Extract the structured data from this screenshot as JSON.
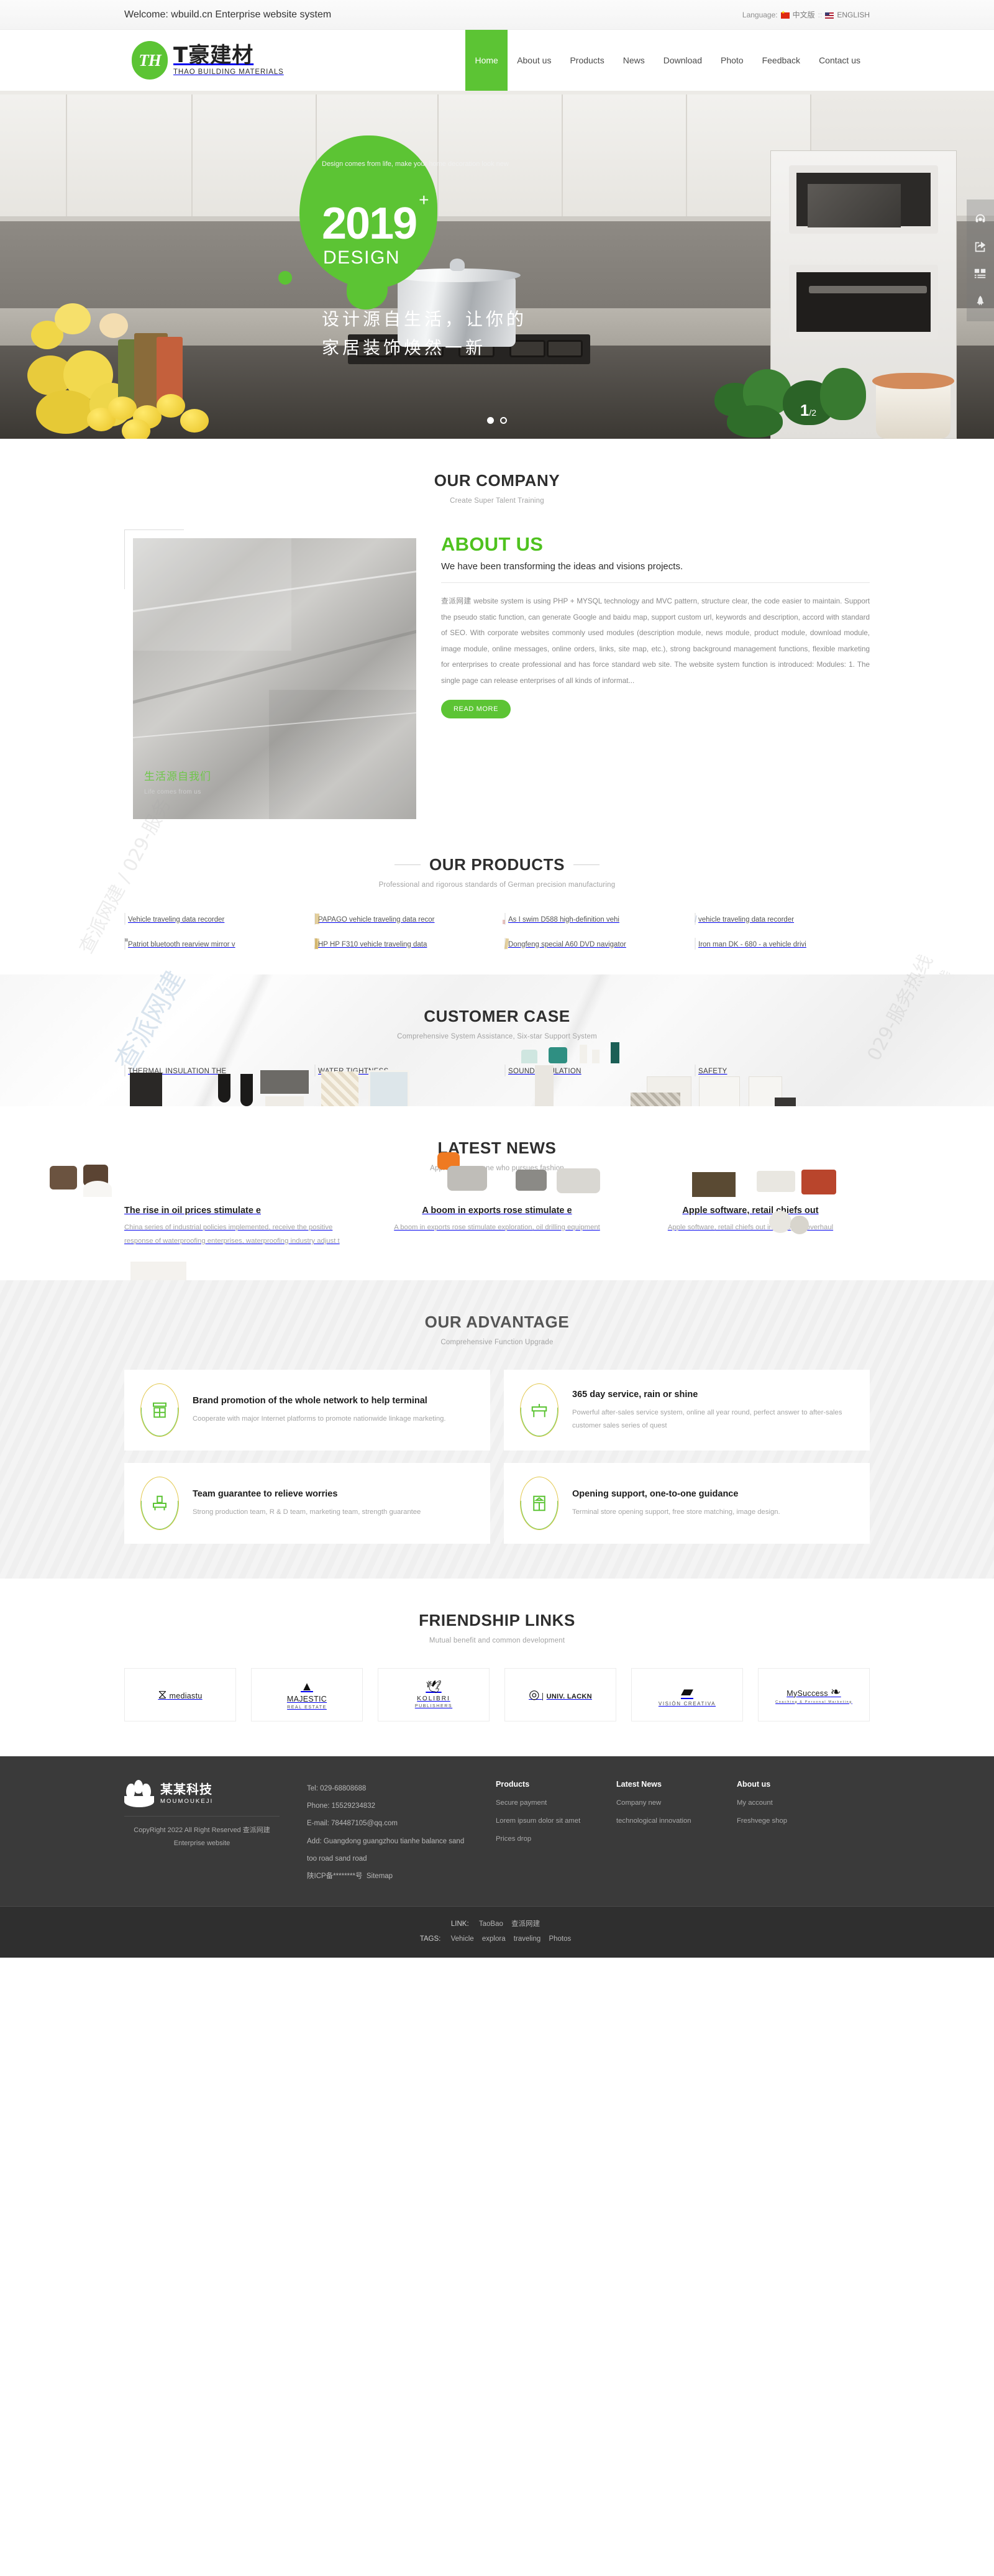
{
  "topbar": {
    "welcome": "Welcome: wbuild.cn Enterprise website system",
    "language_label": "Language:",
    "lang_cn": "中文版",
    "separator": "::",
    "lang_en": "ENGLISH"
  },
  "brand": {
    "mark": "TH",
    "name_cn": "T豪建材",
    "name_en": "THAO BUILDING MATERIALS"
  },
  "nav": {
    "items": [
      {
        "label": "Home",
        "active": true
      },
      {
        "label": "About us",
        "active": false
      },
      {
        "label": "Products",
        "active": false
      },
      {
        "label": "News",
        "active": false
      },
      {
        "label": "Download",
        "active": false
      },
      {
        "label": "Photo",
        "active": false
      },
      {
        "label": "Feedback",
        "active": false
      },
      {
        "label": "Contact us",
        "active": false
      }
    ]
  },
  "hero": {
    "sub_en": "Design comes from life, make your home decoration look new",
    "year": "2019",
    "plus": "+",
    "design": "DESIGN",
    "cn_line1": "设计源自生活，让你的",
    "cn_line2": "家居装饰焕然一新",
    "slide_current": "1",
    "slide_sep": "/",
    "slide_total": "2",
    "accent": "#5cc434"
  },
  "side_tools": [
    {
      "icon": "headset-icon"
    },
    {
      "icon": "share-icon"
    },
    {
      "icon": "qrcode-icon"
    },
    {
      "icon": "rocket-icon"
    }
  ],
  "company": {
    "title": "OUR COMPANY",
    "subtitle": "Create Super Talent Training",
    "image_caption_cn": "生活源自我们",
    "image_caption_en": "Life comes from us",
    "heading": "ABOUT US",
    "lead": "We have been transforming the ideas and visions projects.",
    "body": "查派网建 website system is using PHP + MYSQL technology and MVC pattern, structure clear, the code easier to maintain. Support the pseudo static function, can generate Google and baidu map, support custom url, keywords and description, accord with standard of SEO. With corporate websites commonly used modules (description module, news module, product module, download module, image module, online messages, online orders, links, site map, etc.), strong background management functions, flexible marketing for enterprises to create professional and has force standard web site. The website system function is introduced: Modules: 1. The single page can release enterprises of all kinds of informat...",
    "read_more": "READ MORE"
  },
  "products": {
    "title": "OUR PRODUCTS",
    "subtitle": "Professional and rigorous standards of German precision manufacturing",
    "items": [
      {
        "caption": "Vehicle traveling data recorder"
      },
      {
        "caption": "PAPAGO vehicle traveling data recor"
      },
      {
        "caption": "As I swim D588 high-definition vehi"
      },
      {
        "caption": "vehicle traveling data recorder"
      },
      {
        "caption": "Patriot bluetooth rearview mirror v"
      },
      {
        "caption": "HP HP F310 vehicle traveling data"
      },
      {
        "caption": "Dongfeng special A60 DVD navigator"
      },
      {
        "caption": "Iron man DK - 680 - a vehicle drivi"
      }
    ]
  },
  "cases": {
    "title": "CUSTOMER CASE",
    "subtitle": "Comprehensive System Assistance, Six-star Support System",
    "items": [
      {
        "caption": "THERMAL INSULATION THE"
      },
      {
        "caption": "WATER TIGHTNESS"
      },
      {
        "caption": "SOUND INSULATION"
      },
      {
        "caption": "SAFETY"
      }
    ]
  },
  "news": {
    "title": "LATEST NEWS",
    "subtitle": "Approach everyone who pursues fashion",
    "items": [
      {
        "title": "The rise in oil prices stimulate e",
        "excerpt": "China series of industrial policies implemented, receive the positive response of waterproofing enterprises, waterproofing industry adjust t"
      },
      {
        "title": "A boom in exports rose stimulate e",
        "excerpt": "A boom in exports rose stimulate exploration, oil drilling equipment"
      },
      {
        "title": "Apple software, retail chiefs out",
        "excerpt": "Apple software, retail chiefs out in sweeping overhaul"
      }
    ]
  },
  "advantage": {
    "title": "OUR ADVANTAGE",
    "subtitle": "Comprehensive Function Upgrade",
    "items": [
      {
        "title": "Brand promotion of the whole network to help terminal",
        "desc": "Cooperate with major Internet platforms to promote nationwide linkage marketing.",
        "icon": "cabinet-icon"
      },
      {
        "title": "365 day service, rain or shine",
        "desc": "Powerful after-sales service system, online all year round, perfect answer to after-sales customer sales series of quest",
        "icon": "sink-icon"
      },
      {
        "title": "Team guarantee to relieve worries",
        "desc": "Strong production team, R & D team, marketing team, strength guarantee",
        "icon": "worktable-icon"
      },
      {
        "title": "Opening support, one-to-one guidance",
        "desc": "Terminal store opening support, free store matching, image design.",
        "icon": "wardrobe-icon"
      }
    ]
  },
  "links": {
    "title": "FRIENDSHIP LINKS",
    "subtitle": "Mutual benefit and common development",
    "items": [
      {
        "name": "mediastu",
        "sub": "",
        "glyph": "⧖"
      },
      {
        "name": "MAJESTIC",
        "sub": "REAL ESTATE",
        "glyph": "▲"
      },
      {
        "name": "KOLIBRI",
        "sub": "PUBLISHERS",
        "glyph": "🕊"
      },
      {
        "name": "UNIV. LACKN",
        "sub": "",
        "glyph": "◎"
      },
      {
        "name": "VISIÓN CREATIVA",
        "sub": "",
        "glyph": "▰"
      },
      {
        "name": "MySuccess",
        "sub": "Coaching & Personal Marketing",
        "glyph": "❧"
      }
    ]
  },
  "footer": {
    "brand_cn": "某某科技",
    "brand_en": "MOUMOUKEJI",
    "copyright": "CopyRight 2022 All Right Reserved 查派网建 Enterprise website",
    "contact": {
      "tel": "Tel: 029-68808688",
      "phone": "Phone: 15529234832",
      "email": "E-mail: 784487105@qq.com",
      "address": "Add: Guangdong guangzhou tianhe balance sand too road sand road",
      "icp": "陕ICP备********号",
      "sitemap": "Sitemap"
    },
    "columns": [
      {
        "heading": "Products",
        "links": [
          "Secure payment",
          "Lorem ipsum dolor sit amet",
          "Prices drop"
        ]
      },
      {
        "heading": "Latest News",
        "links": [
          "Company new",
          "technological innovation"
        ]
      },
      {
        "heading": "About us",
        "links": [
          "My account",
          "Freshvege shop"
        ]
      }
    ],
    "bottom": {
      "link_label": "LINK:",
      "link_items": [
        "TaoBao",
        "查派网建"
      ],
      "tags_label": "TAGS:",
      "tag_items": [
        "Vehicle",
        "explora",
        "traveling",
        "Photos"
      ]
    }
  }
}
